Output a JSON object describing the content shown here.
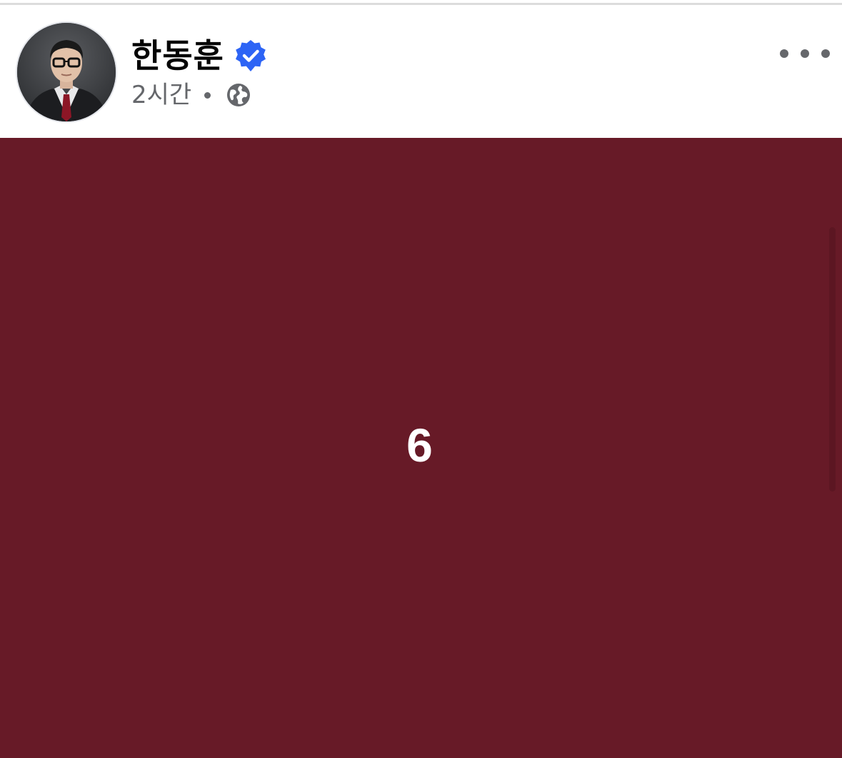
{
  "post": {
    "author": "한동훈",
    "verified": true,
    "timestamp": "2시간",
    "audience_icon": "globe-icon",
    "more_icon": "more-horizontal-icon"
  },
  "media": {
    "counter": "6",
    "background_color": "#671a27"
  },
  "colors": {
    "verified_badge": "#2d64f5",
    "secondary_text": "#65676b"
  }
}
